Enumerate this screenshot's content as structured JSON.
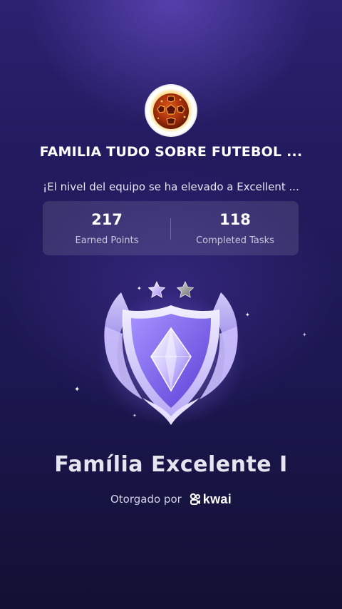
{
  "team": {
    "name": "FAMILIA TUDO SOBRE FUTEBOL ...",
    "level_message": "¡El nivel del equipo se ha elevado a Excellent ...",
    "avatar_icon": "fire-soccer-ball-icon"
  },
  "stats": [
    {
      "value": "217",
      "label": "Earned Points"
    },
    {
      "value": "118",
      "label": "Completed Tasks"
    }
  ],
  "badge": {
    "icon": "shield-crystal-badge-icon",
    "stars_filled": 1,
    "stars_total": 2,
    "title": "Família Excelente I"
  },
  "awarded": {
    "prefix": "Otorgado por",
    "brand": "kwai"
  },
  "colors": {
    "background_top": "#2b2170",
    "background_bottom": "#121033",
    "badge_purple": "#8f78f0",
    "text_muted": "#c9c6de"
  }
}
